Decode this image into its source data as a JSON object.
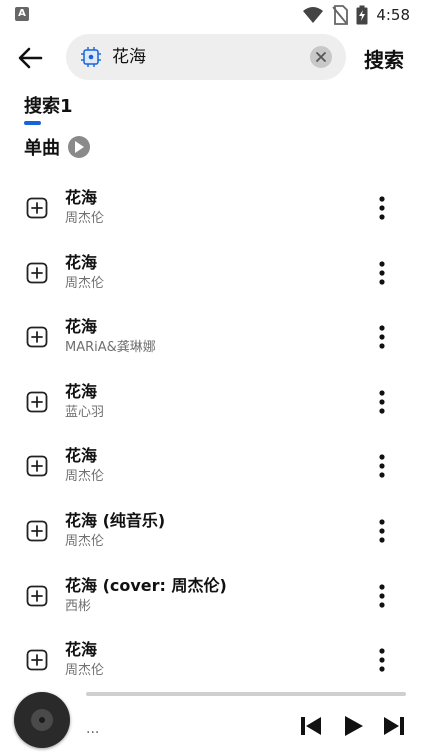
{
  "status_bar": {
    "app_badge": "A",
    "time": "4:58",
    "icons": [
      "wifi-icon",
      "no-sim-icon",
      "battery-charging-icon"
    ]
  },
  "search": {
    "query": "花海",
    "submit_label": "搜索"
  },
  "tab": {
    "label": "搜索1"
  },
  "section": {
    "title": "单曲"
  },
  "songs": [
    {
      "title": "花海",
      "artist": "周杰伦"
    },
    {
      "title": "花海",
      "artist": "周杰伦"
    },
    {
      "title": "花海",
      "artist": "MARiA&龚琳娜"
    },
    {
      "title": "花海",
      "artist": "蓝心羽"
    },
    {
      "title": "花海",
      "artist": "周杰伦"
    },
    {
      "title": "花海 (纯音乐)",
      "artist": "周杰伦"
    },
    {
      "title": "花海 (cover: 周杰伦)",
      "artist": "西彬"
    },
    {
      "title": "花海",
      "artist": "周杰伦"
    }
  ],
  "player": {
    "now_playing": "...",
    "progress": 0
  },
  "colors": {
    "accent": "#1565d8"
  }
}
